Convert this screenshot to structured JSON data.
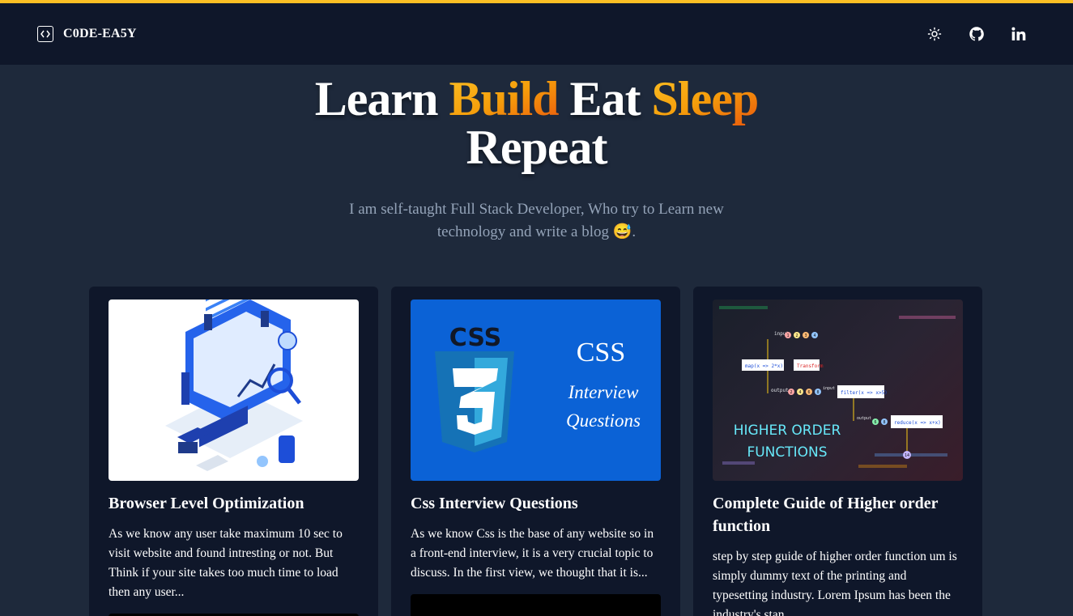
{
  "header": {
    "brand": "C0DE-EA5Y",
    "icons": [
      "code-icon",
      "sun-icon",
      "github-icon",
      "linkedin-icon"
    ]
  },
  "hero": {
    "title_w1": "Learn",
    "title_w2": "Build",
    "title_w3": "Eat",
    "title_w4": "Sleep",
    "title_w5": "Repeat",
    "subtitle": "I am self-taught Full Stack Developer, Who try to Learn new technology and write a blog 😅."
  },
  "posts": [
    {
      "title": "Browser Level Optimization",
      "excerpt": "As we know any user take maximum 10 sec to visit website and found intresting or not. But Think if your site takes too much time to load then any user..."
    },
    {
      "title": "Css Interview Questions",
      "excerpt": "As we know Css is the base of any website so in a front-end interview, it is a very crucial topic to discuss. In the first view, we thought that it is...",
      "image_logo": "CSS",
      "image_heading": "CSS",
      "image_line1": "Interview",
      "image_line2": "Questions"
    },
    {
      "title": "Complete Guide of Higher order function",
      "excerpt": "step by step guide of higher order function um is simply dummy text of the printing and typesetting industry. Lorem Ipsum has been the industry's stan",
      "image_text1": "HIGHER ORDER",
      "image_text2": "FUNCTIONS",
      "diagram": {
        "input": "input",
        "output": "output",
        "map": "map(x => 2*x)",
        "transform": "Transform",
        "filter": "filter(x => x>5)",
        "reduce": "reduce(x => x+x)",
        "in_values": [
          "1",
          "2",
          "3",
          "4"
        ],
        "mid_values": [
          "2",
          "4",
          "6",
          "8"
        ],
        "filter_values": [
          "6",
          "8"
        ],
        "result": "14"
      }
    }
  ],
  "colors": {
    "accent": "#fbbf24",
    "accent_end": "#ea580c",
    "background": "#1e293b",
    "navbar": "#0f172a",
    "card": "#0f172a",
    "muted_text": "#94a3b8"
  }
}
